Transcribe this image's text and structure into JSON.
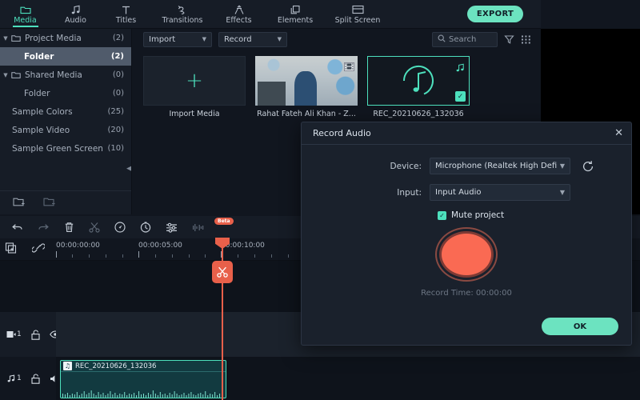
{
  "topbar": {
    "tabs": [
      {
        "label": "Media",
        "icon": "folder-icon",
        "active": true
      },
      {
        "label": "Audio",
        "icon": "music-note-icon",
        "active": false
      },
      {
        "label": "Titles",
        "icon": "text-t-icon",
        "active": false
      },
      {
        "label": "Transitions",
        "icon": "transition-arrows-icon",
        "active": false
      },
      {
        "label": "Effects",
        "icon": "magic-wand-icon",
        "active": false
      },
      {
        "label": "Elements",
        "icon": "layers-icon",
        "active": false
      },
      {
        "label": "Split Screen",
        "icon": "split-screen-icon",
        "active": false
      }
    ],
    "export_label": "EXPORT"
  },
  "sidebar": {
    "items": [
      {
        "label": "Project Media",
        "count": "(2)",
        "caret": "▼",
        "folder": true,
        "selected": false,
        "indent": 0
      },
      {
        "label": "Folder",
        "count": "(2)",
        "caret": "",
        "folder": false,
        "selected": true,
        "indent": 1
      },
      {
        "label": "Shared Media",
        "count": "(0)",
        "caret": "▼",
        "folder": true,
        "selected": false,
        "indent": 0
      },
      {
        "label": "Folder",
        "count": "(0)",
        "caret": "",
        "folder": false,
        "selected": false,
        "indent": 1
      },
      {
        "label": "Sample Colors",
        "count": "(25)",
        "caret": "",
        "folder": false,
        "selected": false,
        "indent": 0
      },
      {
        "label": "Sample Video",
        "count": "(20)",
        "caret": "",
        "folder": false,
        "selected": false,
        "indent": 0
      },
      {
        "label": "Sample Green Screen",
        "count": "(10)",
        "caret": "",
        "folder": false,
        "selected": false,
        "indent": 0
      }
    ],
    "footer": [
      {
        "icon": "add-folder-icon"
      },
      {
        "icon": "remove-folder-icon"
      }
    ],
    "collapse_icon": "collapse-left-arrow-icon"
  },
  "media_toolbar": {
    "import_label": "Import",
    "record_label": "Record",
    "search_placeholder": "Search",
    "filter_icon": "filter-funnel-icon",
    "grid_icon": "grid-view-icon"
  },
  "media_items": [
    {
      "label": "Import Media",
      "type": "import",
      "selected": false,
      "badge": "",
      "corner_icon": ""
    },
    {
      "label": "Rahat Fateh Ali Khan - Z...",
      "type": "video",
      "selected": false,
      "badge": "",
      "corner_icon": "film-strip-icon"
    },
    {
      "label": "REC_20210626_132036",
      "type": "audio",
      "selected": true,
      "badge": "✓",
      "corner_icon": "music-note-icon"
    }
  ],
  "timeline_toolbar": {
    "icons": [
      {
        "name": "undo-icon",
        "dim": false
      },
      {
        "name": "redo-icon",
        "dim": true
      },
      {
        "name": "delete-trash-icon",
        "dim": false
      },
      {
        "name": "split-scissors-icon",
        "dim": true
      },
      {
        "name": "speed-gauge-icon",
        "dim": false
      },
      {
        "name": "freeze-frame-clock-icon",
        "dim": false
      },
      {
        "name": "audio-mixer-icon",
        "dim": false
      },
      {
        "name": "audio-detach-icon",
        "dim": true
      }
    ],
    "beta_label": "Beta"
  },
  "timeline": {
    "head_buttons": [
      {
        "name": "add-track-icon"
      },
      {
        "name": "link-chain-icon"
      }
    ],
    "ruler_labels": [
      "00:00:00:00",
      "00:00:05:00",
      "00:00:10:00"
    ],
    "playhead_icon": "scissors-icon"
  },
  "tracks": [
    {
      "type": "video",
      "index": "1",
      "lock_icon": "unlock-icon",
      "toggle_icon": "eye-icon",
      "clip": null
    },
    {
      "type": "audio",
      "index": "1",
      "lock_icon": "unlock-icon",
      "toggle_icon": "speaker-icon",
      "clip": {
        "label": "REC_20210626_132036",
        "icon": "music-note-icon"
      }
    }
  ],
  "dialog": {
    "title": "Record Audio",
    "close_icon": "close-x-icon",
    "device_label": "Device:",
    "device_value": "Microphone (Realtek High Defini",
    "refresh_icon": "refresh-circular-arrow-icon",
    "input_label": "Input:",
    "input_value": "Input Audio",
    "mute_checked": "✓",
    "mute_label": "Mute project",
    "record_button_icon": "record-circle-icon",
    "record_time": "Record Time: 00:00:00",
    "ok_label": "OK"
  },
  "colors": {
    "accent_teal": "#4de0bd",
    "accent_teal_button": "#6ce3c0",
    "record_red": "#fa6a53",
    "playhead_red": "#e8604a",
    "panel_bg": "#161c26",
    "app_bg": "#11161f",
    "dialog_bg": "#1a212c"
  }
}
